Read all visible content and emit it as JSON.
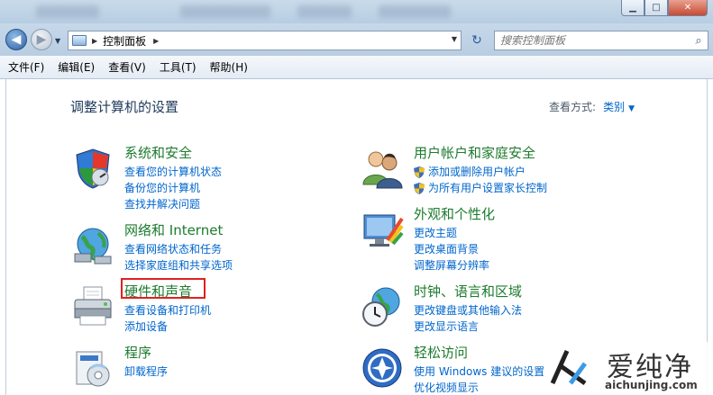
{
  "window": {
    "minimize_glyph": "▁",
    "maximize_glyph": "□",
    "close_glyph": "✕"
  },
  "nav": {
    "back_glyph": "◀",
    "forward_glyph": "▶",
    "breadcrumb": "控制面板",
    "refresh_glyph": "↻",
    "search_placeholder": "搜索控制面板"
  },
  "menu": [
    "文件(F)",
    "编辑(E)",
    "查看(V)",
    "工具(T)",
    "帮助(H)"
  ],
  "content": {
    "title": "调整计算机的设置",
    "view_by_label": "查看方式:",
    "view_by_value": "类别"
  },
  "categories": [
    {
      "name": "系统和安全",
      "icon": "shield-icon",
      "links": [
        "查看您的计算机状态",
        "备份您的计算机",
        "查找并解决问题"
      ]
    },
    {
      "name": "网络和 Internet",
      "icon": "network-icon",
      "links": [
        "查看网络状态和任务",
        "选择家庭组和共享选项"
      ]
    },
    {
      "name": "硬件和声音",
      "icon": "printer-icon",
      "links": [
        "查看设备和打印机",
        "添加设备"
      ]
    },
    {
      "name": "程序",
      "icon": "programs-icon",
      "links": [
        "卸载程序"
      ]
    },
    {
      "name": "用户帐户和家庭安全",
      "icon": "users-icon",
      "links": [
        "添加或删除用户帐户",
        "为所有用户设置家长控制"
      ]
    },
    {
      "name": "外观和个性化",
      "icon": "appearance-icon",
      "links": [
        "更改主题",
        "更改桌面背景",
        "调整屏幕分辨率"
      ]
    },
    {
      "name": "时钟、语言和区域",
      "icon": "clock-globe-icon",
      "links": [
        "更改键盘或其他输入法",
        "更改显示语言"
      ]
    },
    {
      "name": "轻松访问",
      "icon": "ease-of-access-icon",
      "links": [
        "使用 Windows 建议的设置",
        "优化视频显示"
      ]
    }
  ],
  "watermark": {
    "brand": "爱纯净",
    "url": "aichunjing.com"
  },
  "colors": {
    "category_heading": "#1d7b2e",
    "link": "#0066cc",
    "highlight_box": "#e02020"
  }
}
